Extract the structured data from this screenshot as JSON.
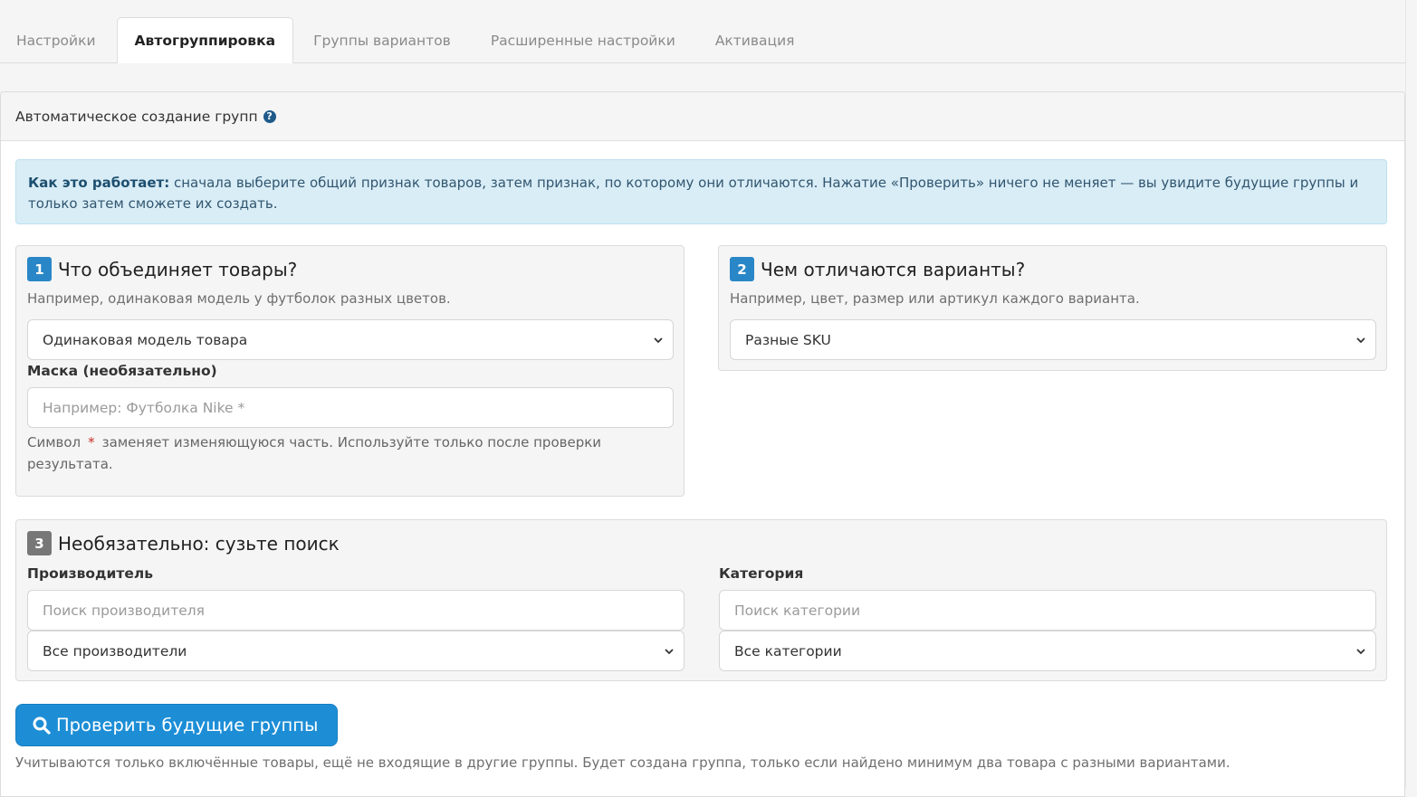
{
  "tabs": [
    {
      "label": "Настройки",
      "active": false
    },
    {
      "label": "Автогруппировка",
      "active": true
    },
    {
      "label": "Группы вариантов",
      "active": false
    },
    {
      "label": "Расширенные настройки",
      "active": false
    },
    {
      "label": "Активация",
      "active": false
    }
  ],
  "panel": {
    "title": "Автоматическое создание групп",
    "help_icon": "question-circle-icon"
  },
  "info": {
    "bold": "Как это работает:",
    "text": " сначала выберите общий признак товаров, затем признак, по которому они отличаются. Нажатие «Проверить» ничего не меняет — вы увидите будущие группы и только затем сможете их создать."
  },
  "step1": {
    "number": "1",
    "title": "Что объединяет товары?",
    "hint": "Например, одинаковая модель у футболок разных цветов.",
    "select_value": "Одинаковая модель товара",
    "mask_label": "Маска (необязательно)",
    "mask_placeholder": "Например: Футболка Nike *",
    "mask_desc_before": "Символ",
    "mask_desc_star": "*",
    "mask_desc_after": "заменяет изменяющуюся часть. Используйте только после проверки результата."
  },
  "step2": {
    "number": "2",
    "title": "Чем отличаются варианты?",
    "hint": "Например, цвет, размер или артикул каждого варианта.",
    "select_value": "Разные SKU"
  },
  "step3": {
    "number": "3",
    "title": "Необязательно: сузьте поиск",
    "manufacturer_label": "Производитель",
    "manufacturer_placeholder": "Поиск производителя",
    "manufacturer_select": "Все производители",
    "category_label": "Категория",
    "category_placeholder": "Поиск категории",
    "category_select": "Все категории"
  },
  "actions": {
    "check_button": "Проверить будущие группы",
    "check_icon": "search-icon",
    "footnote": "Учитываются только включённые товары, ещё не входящие в другие группы. Будет создана группа, только если найдено минимум два товара с разными вариантами."
  },
  "colors": {
    "accent": "#1d8ed6",
    "badge_blue": "#2a87c7",
    "badge_gray": "#777777",
    "info_bg": "#d9edf7"
  }
}
